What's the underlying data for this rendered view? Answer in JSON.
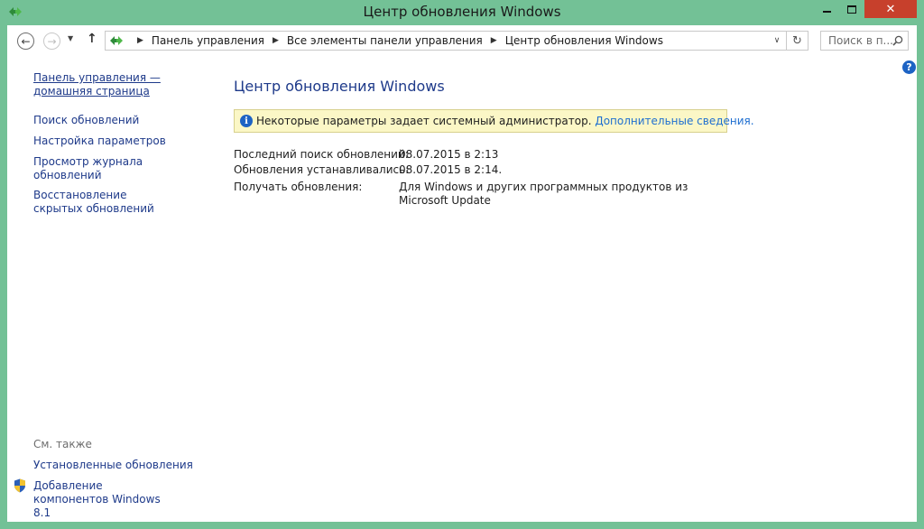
{
  "window": {
    "title": "Центр обновления Windows",
    "close_glyph": "✕"
  },
  "nav": {
    "back_glyph": "←",
    "forward_glyph": "→",
    "recent_glyph": "▼",
    "up_glyph": "↑",
    "breadcrumbs": [
      "Панель управления",
      "Все элементы панели управления",
      "Центр обновления Windows"
    ],
    "separator_glyph": "▶",
    "dropdown_glyph": "∨",
    "refresh_glyph": "↻",
    "search_placeholder": "Поиск в п..."
  },
  "sidebar": {
    "home_link": "Панель управления — домашняя страница",
    "links": [
      "Поиск обновлений",
      "Настройка параметров",
      "Просмотр журнала обновлений",
      "Восстановление скрытых обновлений"
    ],
    "see_also_title": "См. также",
    "see_also": [
      "Установленные обновления",
      "Добавление компонентов Windows 8.1"
    ]
  },
  "help_glyph": "?",
  "main": {
    "title": "Центр обновления Windows",
    "info": {
      "icon_glyph": "i",
      "text": "Некоторые параметры задает системный администратор. ",
      "link": "Дополнительные сведения."
    },
    "properties": [
      {
        "label": "Последний поиск обновлений:",
        "value": "08.07.2015 в 2:13"
      },
      {
        "label": "Обновления устанавливались:",
        "value": "08.07.2015 в 2:14."
      },
      {
        "label": "Получать обновления:",
        "value": "Для Windows и других программных продуктов из Microsoft Update"
      }
    ]
  },
  "colors": {
    "frame": "#73c196",
    "close_button": "#c7402c",
    "link": "#1e3a8a",
    "info_background": "#fbf7c6"
  }
}
